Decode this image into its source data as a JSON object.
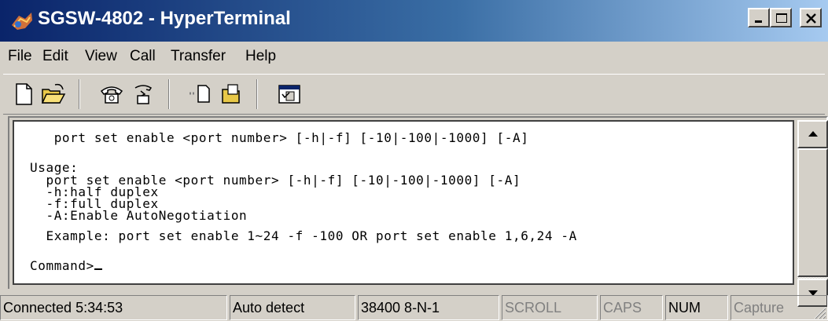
{
  "window": {
    "title": "SGSW-4802 - HyperTerminal",
    "colors": {
      "titlebar_start": "#0a246a",
      "titlebar_end": "#a6caf0",
      "chrome": "#d4d0c8",
      "terminal_bg": "#ffffff"
    },
    "caption_buttons": [
      "minimize-icon",
      "maximize-icon",
      "close-icon"
    ]
  },
  "menu": [
    "File",
    "Edit",
    "View",
    "Call",
    "Transfer",
    "Help"
  ],
  "toolbar": {
    "tools": [
      "new-connection-icon",
      "open-icon",
      "connect-icon",
      "disconnect-icon",
      "send-icon",
      "receive-icon",
      "properties-icon"
    ]
  },
  "terminal": {
    "lines": [
      "   port set enable <port number> [-h|-f] [-10|-100|-1000] [-A]",
      "Usage:",
      "  port set enable <port number> [-h|-f] [-10|-100|-1000] [-A]",
      "  -h:half duplex",
      "  -f:full duplex",
      "  -A:Enable AutoNegotiation",
      "  Example: port set enable 1~24 -f -100 OR port set enable 1,6,24 -A",
      "Command>"
    ]
  },
  "statusbar": {
    "connected": "Connected 5:34:53",
    "detect": "Auto detect",
    "port_settings": "38400 8-N-1",
    "scroll": "SCROLL",
    "caps": "CAPS",
    "num": "NUM",
    "capture": "Capture"
  }
}
